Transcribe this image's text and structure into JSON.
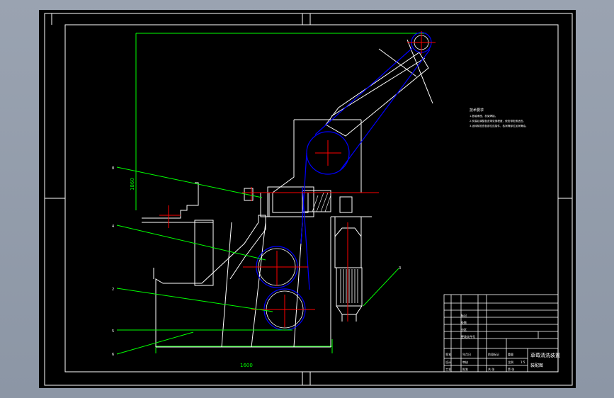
{
  "drawing": {
    "dim_width": "1600",
    "dim_height": "1860",
    "balloons": [
      "8",
      "4",
      "2",
      "5",
      "6",
      "3"
    ],
    "notes": {
      "title": "技术要求",
      "lines": [
        "1.各轴承座、机架焊接。",
        "2.安装后调整各皮带张紧程度，使皮带松紧适宜。",
        "3.运转前检查各部位连接件，各润滑部位加润滑油。"
      ]
    },
    "title_block": {
      "drawing_name": "草莓清洗装置",
      "small_labels": [
        "标记",
        "处数",
        "分区",
        "更改文件号",
        "签名",
        "年月日",
        "设计",
        "审核",
        "工艺",
        "批准",
        "阶段标记",
        "重量",
        "比例",
        "共 张",
        "第 张"
      ],
      "sheet_label": "装配图",
      "scale": "1:5"
    },
    "colors": {
      "background": "#000000",
      "outline": "#ffffff",
      "centerline": "#ff0000",
      "hidden": "#0000ff",
      "leader": "#00ff00"
    }
  }
}
